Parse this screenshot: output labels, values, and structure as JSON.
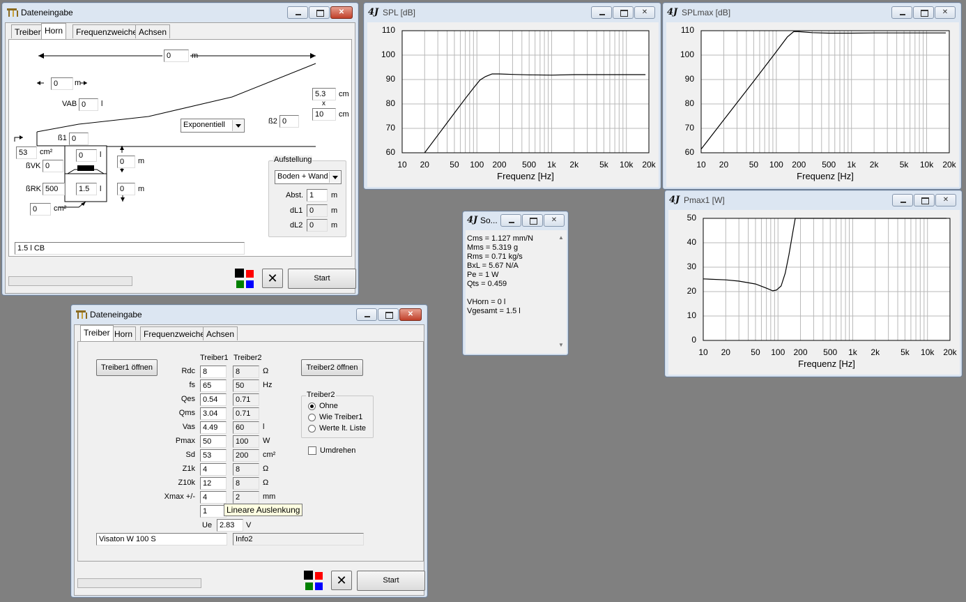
{
  "horn_window": {
    "title": "Dateneingabe",
    "tabs": [
      "Treiber",
      "Horn",
      "Frequenzweiche",
      "Achsen"
    ],
    "length_value": "0",
    "length_unit": "m",
    "seg_value": "0",
    "seg_unit": "m",
    "vab_label": "VAB",
    "vab_value": "0",
    "vab_unit": "l",
    "b1_label": "ß1",
    "b1_value": "0",
    "b2_label": "ß2",
    "b2_value": "0",
    "mouth_w": "5.3",
    "mouth_w_unit": "cm",
    "x_sign": "x",
    "mouth_h": "10",
    "mouth_h_unit": "cm",
    "throat_value": "53",
    "throat_unit": "cm²",
    "flare": "Exponentiell",
    "bvk_label": "ßVK",
    "bvk_value": "0",
    "brk_label": "ßRK",
    "brk_value": "500",
    "vk_value": "0",
    "vk_unit": "l",
    "rk_value": "1.5",
    "rk_unit": "l",
    "d1_value": "0",
    "d1_unit": "m",
    "d2_value": "0",
    "d2_unit": "m",
    "port_value": "0",
    "port_unit": "cm²",
    "aufstellung_label": "Aufstellung",
    "aufstellung_value": "Boden + Wand",
    "abst_label": "Abst.",
    "abst_value": "1",
    "abst_unit": "m",
    "dl1_label": "dL1",
    "dl1_value": "0",
    "dl1_unit": "m",
    "dl2_label": "dL2",
    "dl2_value": "0",
    "dl2_unit": "m",
    "comment": "1.5 l CB",
    "close_symbol": "✕",
    "start_label": "Start"
  },
  "driver_window": {
    "title": "Dateneingabe",
    "tabs": [
      "Treiber",
      "Horn",
      "Frequenzweiche",
      "Achsen"
    ],
    "open1": "Treiber1 öffnen",
    "open2": "Treiber2 öffnen",
    "col1": "Treiber1",
    "col2": "Treiber2",
    "rows": [
      {
        "label": "Rdc",
        "v1": "8",
        "v2": "8",
        "unit": "Ω"
      },
      {
        "label": "fs",
        "v1": "65",
        "v2": "50",
        "unit": "Hz"
      },
      {
        "label": "Qes",
        "v1": "0.54",
        "v2": "0.71",
        "unit": ""
      },
      {
        "label": "Qms",
        "v1": "3.04",
        "v2": "0.71",
        "unit": ""
      },
      {
        "label": "Vas",
        "v1": "4.49",
        "v2": "60",
        "unit": "l"
      },
      {
        "label": "Pmax",
        "v1": "50",
        "v2": "100",
        "unit": "W"
      },
      {
        "label": "Sd",
        "v1": "53",
        "v2": "200",
        "unit": "cm²"
      },
      {
        "label": "Z1k",
        "v1": "4",
        "v2": "8",
        "unit": "Ω"
      },
      {
        "label": "Z10k",
        "v1": "12",
        "v2": "8",
        "unit": "Ω"
      },
      {
        "label": "Xmax +/-",
        "v1": "4",
        "v2": "2",
        "unit": "mm"
      }
    ],
    "extra_value": "1",
    "tooltip": "Lineare Auslenkung",
    "ue_label": "Ue",
    "ue_value": "2.83",
    "ue_unit": "V",
    "name1": "Visaton W 100 S",
    "name2": "Info2",
    "treiber2_group": "Treiber2",
    "radios": [
      "Ohne",
      "Wie Treiber1",
      "Werte lt. Liste"
    ],
    "umdrehen": "Umdrehen",
    "close_symbol": "✕",
    "start_label": "Start"
  },
  "info_window": {
    "title": "So...",
    "lines": [
      "Cms = 1.127 mm/N",
      "Mms = 5.319 g",
      "Rms = 0.71 kg/s",
      "BxL = 5.67 N/A",
      "Pe = 1 W",
      "Qts = 0.459",
      "",
      "VHorn = 0 l",
      "Vgesamt = 1.5 l"
    ]
  },
  "colors": {
    "black": "#000000",
    "red": "#ff0000",
    "green": "#008000",
    "blue": "#0000ff"
  },
  "chart_data": [
    {
      "type": "line",
      "title": "SPL [dB]",
      "xlabel": "Frequenz [Hz]",
      "ylabel": "",
      "xscale": "log",
      "xlim": [
        10,
        20000
      ],
      "ylim": [
        60,
        110
      ],
      "xticks": [
        10,
        20,
        50,
        100,
        200,
        500,
        1000,
        2000,
        5000,
        10000,
        20000
      ],
      "xticklabels": [
        "10",
        "20",
        "50",
        "100",
        "200",
        "500",
        "1k",
        "2k",
        "5k",
        "10k",
        "20k"
      ],
      "yticks": [
        60,
        70,
        80,
        90,
        100,
        110
      ],
      "grid": true,
      "x": [
        20,
        30,
        50,
        70,
        90,
        110,
        130,
        160,
        200,
        300,
        500,
        1000,
        2000,
        5000,
        10000,
        18000
      ],
      "y": [
        60,
        67.2,
        76.3,
        82.2,
        86.5,
        89.8,
        91.2,
        92.3,
        92.3,
        92.1,
        91.9,
        91.8,
        92.0,
        92.0,
        92.0,
        92.0
      ]
    },
    {
      "type": "line",
      "title": "SPLmax [dB]",
      "xlabel": "Frequenz [Hz]",
      "ylabel": "",
      "xscale": "log",
      "xlim": [
        10,
        20000
      ],
      "ylim": [
        60,
        110
      ],
      "xticks": [
        10,
        20,
        50,
        100,
        200,
        500,
        1000,
        2000,
        5000,
        10000,
        20000
      ],
      "xticklabels": [
        "10",
        "20",
        "50",
        "100",
        "200",
        "500",
        "1k",
        "2k",
        "5k",
        "10k",
        "20k"
      ],
      "yticks": [
        60,
        70,
        80,
        90,
        100,
        110
      ],
      "grid": true,
      "x": [
        10,
        20,
        50,
        100,
        140,
        170,
        200,
        300,
        500,
        1000,
        2000,
        5000,
        10000,
        18000
      ],
      "y": [
        61.5,
        73.5,
        89.3,
        101.4,
        107.4,
        109.6,
        109.6,
        109.2,
        109.0,
        109.0,
        109.1,
        109.1,
        109.1,
        109.1
      ]
    },
    {
      "type": "line",
      "title": "Pmax1 [W]",
      "xlabel": "Frequenz [Hz]",
      "ylabel": "",
      "xscale": "log",
      "xlim": [
        10,
        20000
      ],
      "ylim": [
        0,
        50
      ],
      "xticks": [
        10,
        20,
        50,
        100,
        200,
        500,
        1000,
        2000,
        5000,
        10000,
        20000
      ],
      "xticklabels": [
        "10",
        "20",
        "50",
        "100",
        "200",
        "500",
        "1k",
        "2k",
        "5k",
        "10k",
        "20k"
      ],
      "yticks": [
        0,
        10,
        20,
        30,
        40,
        50
      ],
      "grid": true,
      "x": [
        10,
        20,
        30,
        50,
        70,
        85,
        95,
        110,
        125,
        140,
        155,
        170,
        200,
        500,
        1000,
        5000,
        18000
      ],
      "y": [
        25.2,
        24.8,
        24.3,
        23.1,
        21.4,
        20.3,
        20.6,
        22.3,
        27.5,
        35.0,
        43.0,
        50.0,
        50.0,
        50.0,
        50.0,
        50.0,
        50.0
      ]
    }
  ]
}
